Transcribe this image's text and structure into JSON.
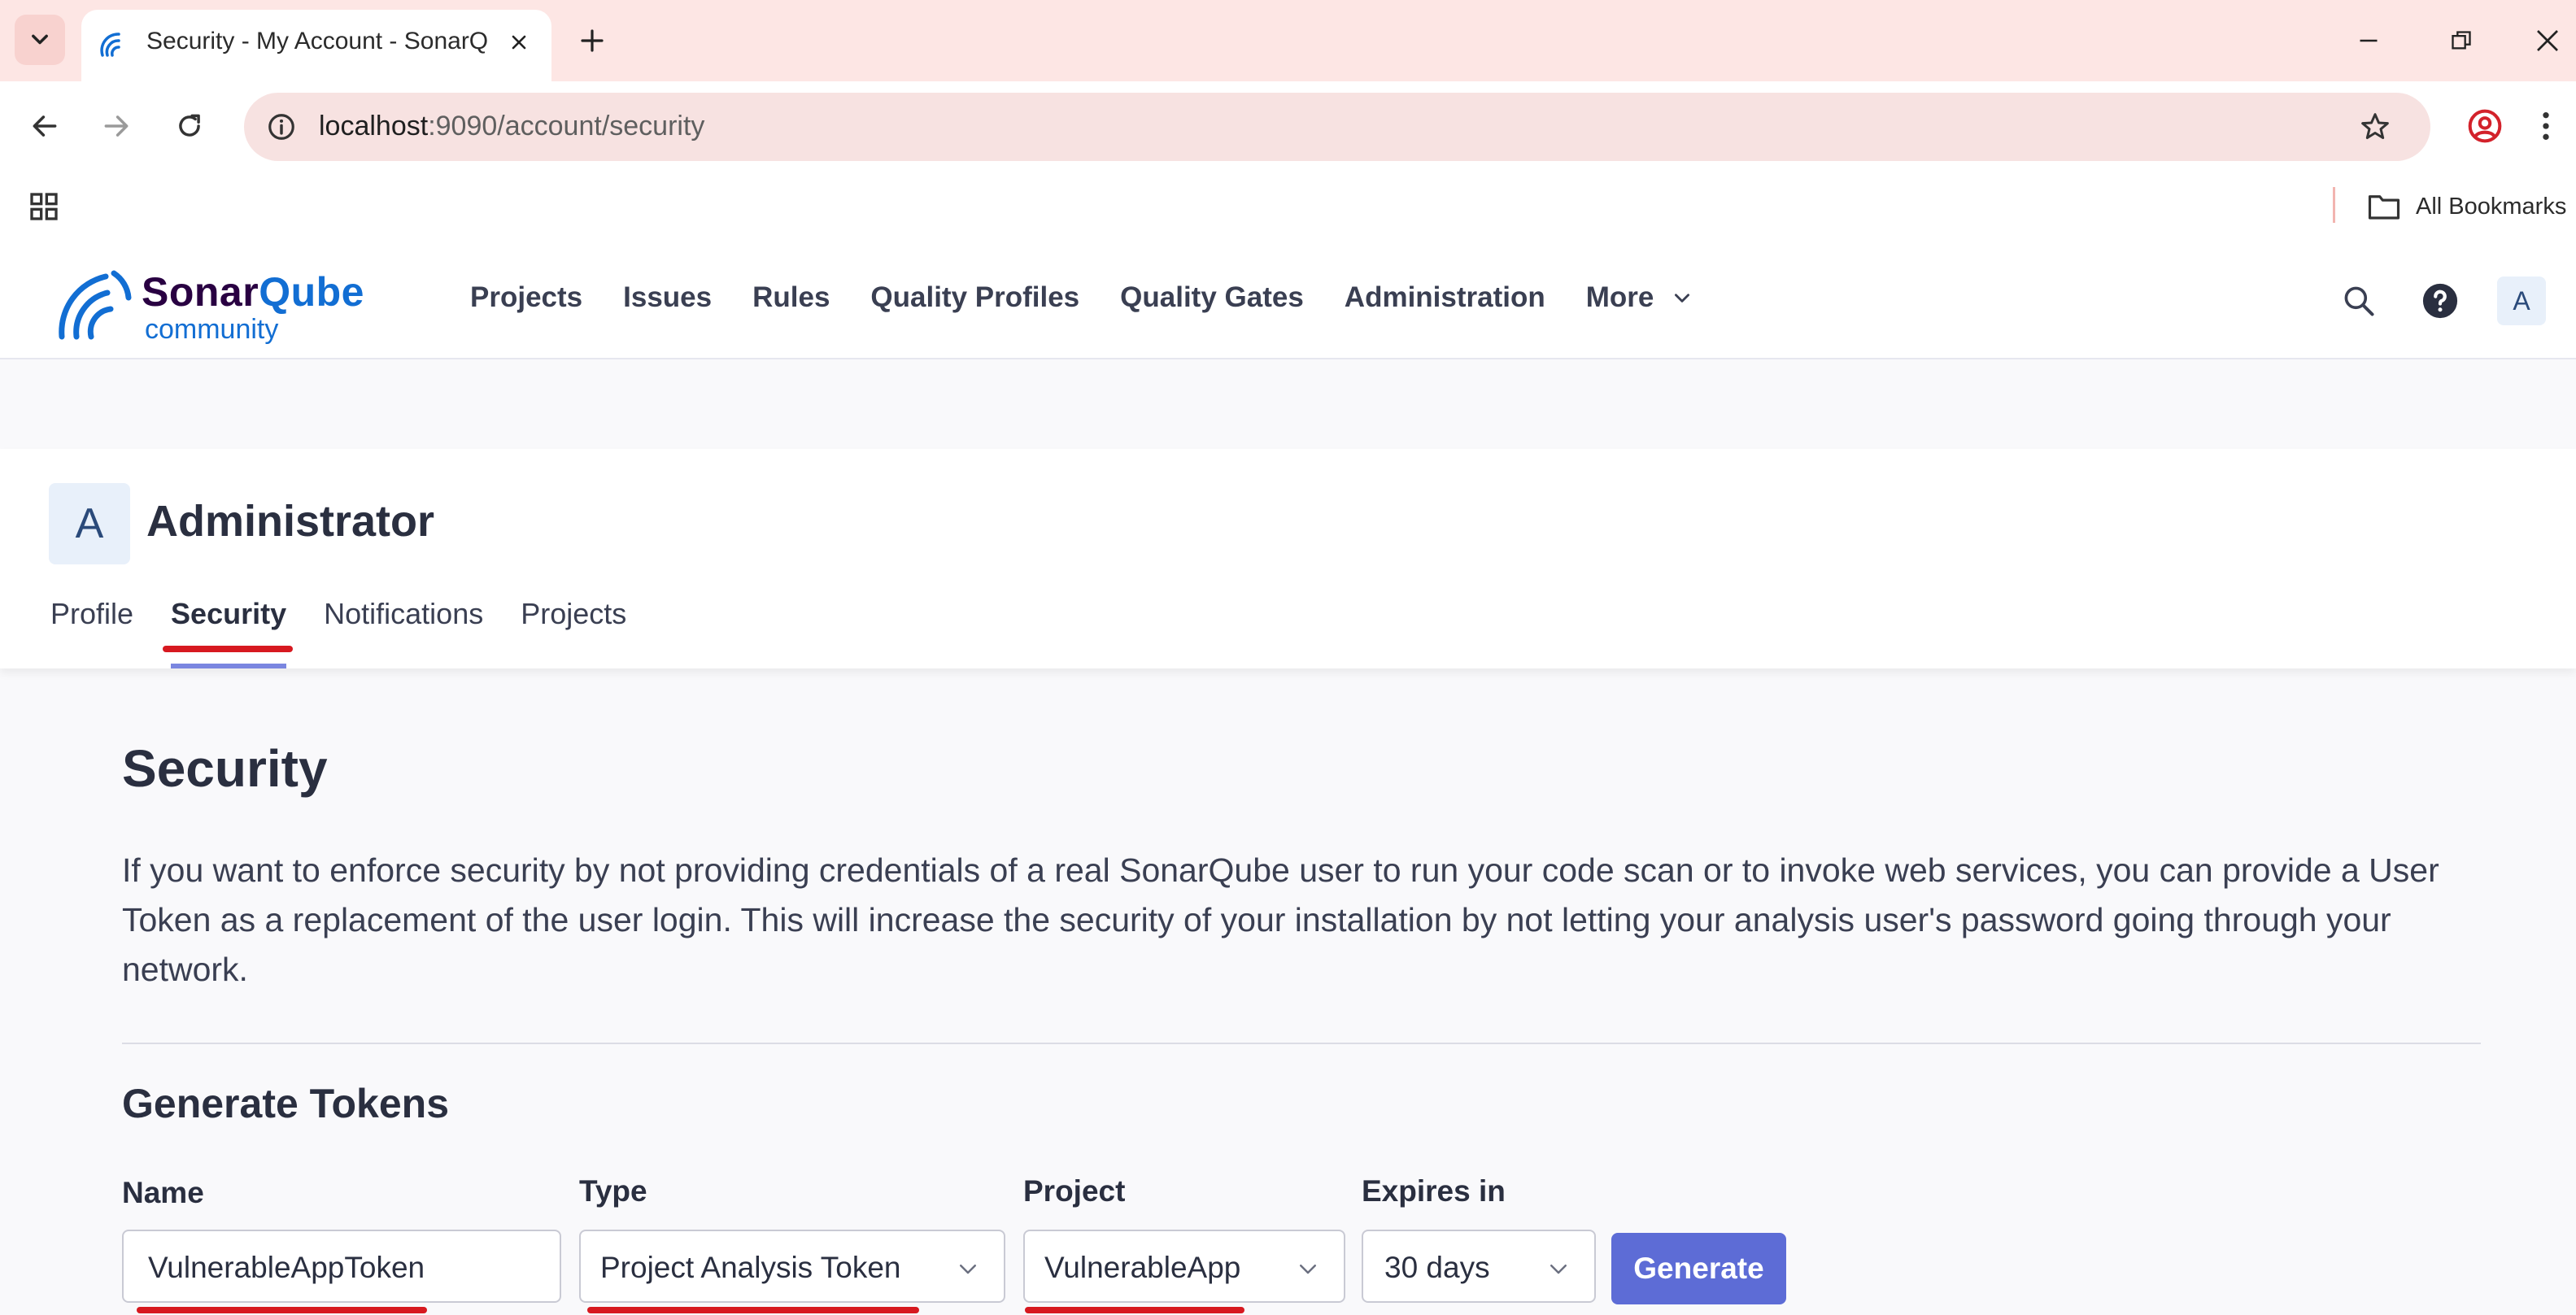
{
  "browser": {
    "tab_title": "Security - My Account - SonarQube",
    "url_host": "localhost",
    "url_path": ":9090/account/security",
    "bookmarks_label": "All Bookmarks"
  },
  "header": {
    "logo_name_prefix": "Sonar",
    "logo_name_accent": "Qube",
    "logo_edition": "community",
    "nav": [
      "Projects",
      "Issues",
      "Rules",
      "Quality Profiles",
      "Quality Gates",
      "Administration"
    ],
    "more_label": "More",
    "avatar_letter": "A"
  },
  "account": {
    "avatar_letter": "A",
    "name": "Administrator",
    "tabs": [
      "Profile",
      "Security",
      "Notifications",
      "Projects"
    ],
    "active_tab": "Security"
  },
  "security": {
    "title": "Security",
    "description": "If you want to enforce security by not providing credentials of a real SonarQube user to run your code scan or to invoke web services, you can provide a User Token as a replacement of the user login. This will increase the security of your installation by not letting your analysis user's password going through your network.",
    "generate_title": "Generate Tokens",
    "form": {
      "name_label": "Name",
      "name_value": "VulnerableAppToken",
      "type_label": "Type",
      "type_value": "Project Analysis Token",
      "project_label": "Project",
      "project_value": "VulnerableApp",
      "expires_label": "Expires in",
      "expires_value": "30 days",
      "generate_label": "Generate"
    }
  },
  "colors": {
    "chrome_bg": "#fde6e4",
    "accent": "#5d6cd6",
    "annotation_red": "#d71920",
    "brand_blue": "#126ed3"
  }
}
